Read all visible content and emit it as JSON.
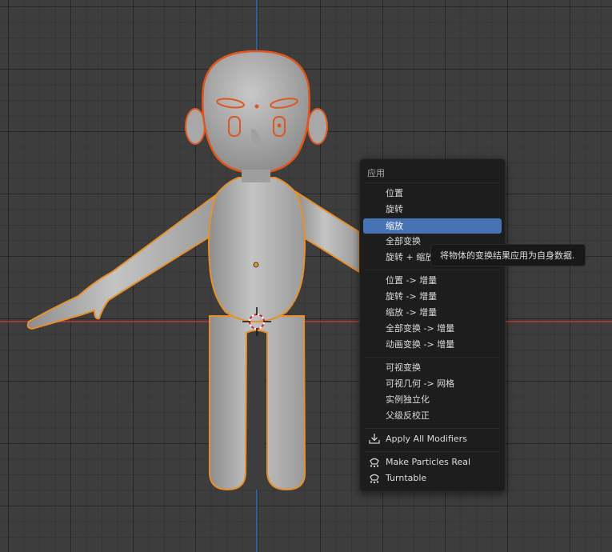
{
  "menu": {
    "title": "应用",
    "items": [
      {
        "label": "位置"
      },
      {
        "label": "旋转"
      },
      {
        "label": "缩放"
      },
      {
        "label": "全部变换"
      },
      {
        "label": "旋转 + 缩放"
      },
      {
        "label": "位置 -> 增量"
      },
      {
        "label": "旋转 -> 增量"
      },
      {
        "label": "缩放 -> 增量"
      },
      {
        "label": "全部变换 -> 增量"
      },
      {
        "label": "动画变换 -> 增量"
      },
      {
        "label": "可视变换"
      },
      {
        "label": "可视几何 -> 网格"
      },
      {
        "label": "实例独立化"
      },
      {
        "label": "父级反校正"
      },
      {
        "label": "Apply All Modifiers",
        "icon": "download-icon"
      },
      {
        "label": "Make Particles Real",
        "icon": "particles-icon"
      },
      {
        "label": "Turntable",
        "icon": "particles-icon"
      }
    ],
    "active_item": "缩放"
  },
  "tooltip": {
    "text": "将物体的变换结果应用为自身数据."
  },
  "colors": {
    "viewport_bg": "#3d3d3d",
    "menu_bg": "#1d1d1d",
    "highlight": "#4772b3",
    "selection_outline": "#e8902a",
    "active_outline": "#e2561e",
    "x_axis": "#9a3a3a",
    "y_axis": "#2f5f9c"
  }
}
